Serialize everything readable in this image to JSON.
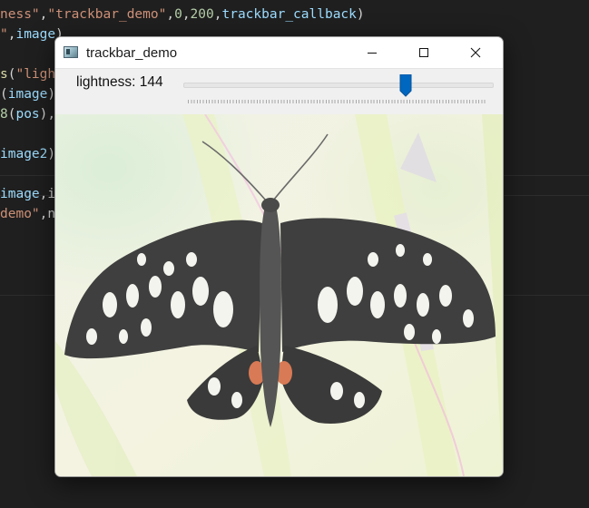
{
  "editor": {
    "lines": [
      [
        {
          "t": "ness\"",
          "c": "tok-str"
        },
        {
          "t": ",",
          "c": "tok-plain"
        },
        {
          "t": "\"trackbar_demo\"",
          "c": "tok-str"
        },
        {
          "t": ",",
          "c": "tok-plain"
        },
        {
          "t": "0",
          "c": "tok-num"
        },
        {
          "t": ",",
          "c": "tok-plain"
        },
        {
          "t": "200",
          "c": "tok-num"
        },
        {
          "t": ",",
          "c": "tok-plain"
        },
        {
          "t": "trackbar_callback",
          "c": "tok-var"
        },
        {
          "t": ")",
          "c": "tok-plain"
        }
      ],
      [
        {
          "t": "\"",
          "c": "tok-str"
        },
        {
          "t": ",",
          "c": "tok-plain"
        },
        {
          "t": "image",
          "c": "tok-var"
        },
        {
          "t": ")",
          "c": "tok-plain"
        }
      ],
      [],
      [
        {
          "t": "s",
          "c": "tok-fn"
        },
        {
          "t": "(",
          "c": "tok-plain"
        },
        {
          "t": "\"ligh",
          "c": "tok-str"
        }
      ],
      [
        {
          "t": "(",
          "c": "tok-plain"
        },
        {
          "t": "image",
          "c": "tok-var"
        },
        {
          "t": ")",
          "c": "tok-plain"
        }
      ],
      [
        {
          "t": "8",
          "c": "tok-num"
        },
        {
          "t": "(",
          "c": "tok-plain"
        },
        {
          "t": "pos",
          "c": "tok-var"
        },
        {
          "t": "),",
          "c": "tok-plain"
        }
      ],
      [],
      [
        {
          "t": "image2",
          "c": "tok-var"
        },
        {
          "t": ")",
          "c": "tok-plain"
        }
      ],
      [],
      [
        {
          "t": "image",
          "c": "tok-var"
        },
        {
          "t": ",i",
          "c": "tok-plain"
        }
      ],
      [
        {
          "t": "demo\"",
          "c": "tok-str"
        },
        {
          "t": ",n",
          "c": "tok-plain"
        }
      ]
    ]
  },
  "window": {
    "title": "trackbar_demo",
    "icons": {
      "app": "app-icon",
      "minimize": "minimize-icon",
      "maximize": "maximize-icon",
      "close": "close-icon"
    }
  },
  "trackbar": {
    "label": "lightness: 144",
    "name": "lightness",
    "value": 144,
    "min": 0,
    "max": 200,
    "accent": "#0067c0"
  },
  "image": {
    "subject": "butterfly-photo",
    "icon": "butterfly-image"
  }
}
